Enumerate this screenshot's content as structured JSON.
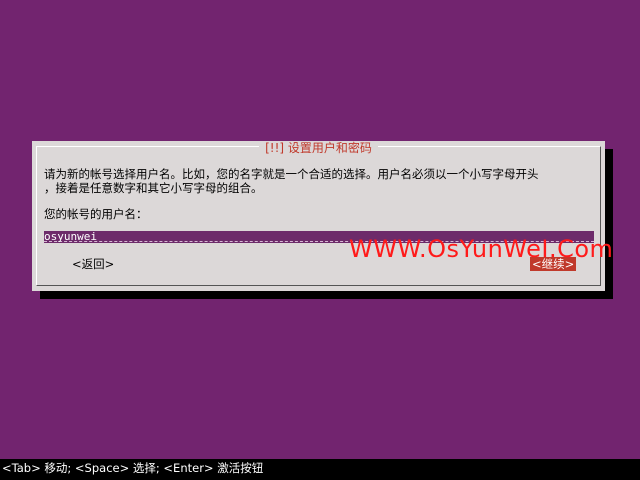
{
  "dialog": {
    "title": "[!!] 设置用户和密码",
    "description": "请为新的帐号选择用户名。比如，您的名字就是一个合适的选择。用户名必须以一个小写字母开头\n，接着是任意数字和其它小写字母的组合。",
    "prompt": "您的帐号的用户名：",
    "username_value": "osyunwei",
    "back_label": "<返回>",
    "continue_label": "<继续>"
  },
  "watermark": "WWW.OsYunWeI.Com",
  "statusbar": {
    "hint": "<Tab> 移动; <Space> 选择; <Enter> 激活按钮"
  },
  "colors": {
    "background": "#72246f",
    "dialog": "#dcd8d8",
    "accent": "#c0392b",
    "input_bg": "#6d2b6a"
  }
}
